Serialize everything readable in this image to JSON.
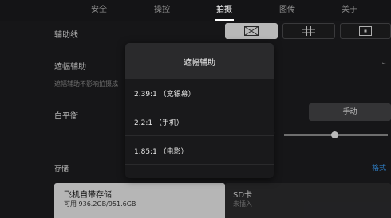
{
  "tabs": [
    {
      "label": "安全"
    },
    {
      "label": "操控"
    },
    {
      "label": "拍摄"
    },
    {
      "label": "图传"
    },
    {
      "label": "关于"
    }
  ],
  "active_tab": "拍摄",
  "settings": {
    "gridlines_label": "辅助线",
    "mask_label": "遮幅辅助",
    "mask_hint": "遮幅辅助不影响拍摄成",
    "white_balance_label": "白平衡",
    "white_balance_mode": "手动",
    "storage_label": "存储",
    "format_link": "格式"
  },
  "storage": {
    "internal": {
      "title": "飞机自带存储",
      "detail": "可用 936.2GB/951.6GB"
    },
    "sd": {
      "title": "SD卡",
      "detail": "未插入"
    }
  },
  "modal": {
    "title": "遮幅辅助",
    "options": [
      {
        "label": "2.39:1 （宽银幕）"
      },
      {
        "label": "2.2:1 （手机）"
      },
      {
        "label": "1.85:1 （电影）"
      }
    ]
  },
  "colors": {
    "accent": "#3a9bf3",
    "background": "#1d1d1f",
    "modal": "#19191b"
  },
  "icons": {
    "gridline_none": "diagonal-cross-icon",
    "gridline_thirds": "grid-icon",
    "gridline_center": "center-point-icon",
    "dropdown": "chevron-down-icon"
  }
}
